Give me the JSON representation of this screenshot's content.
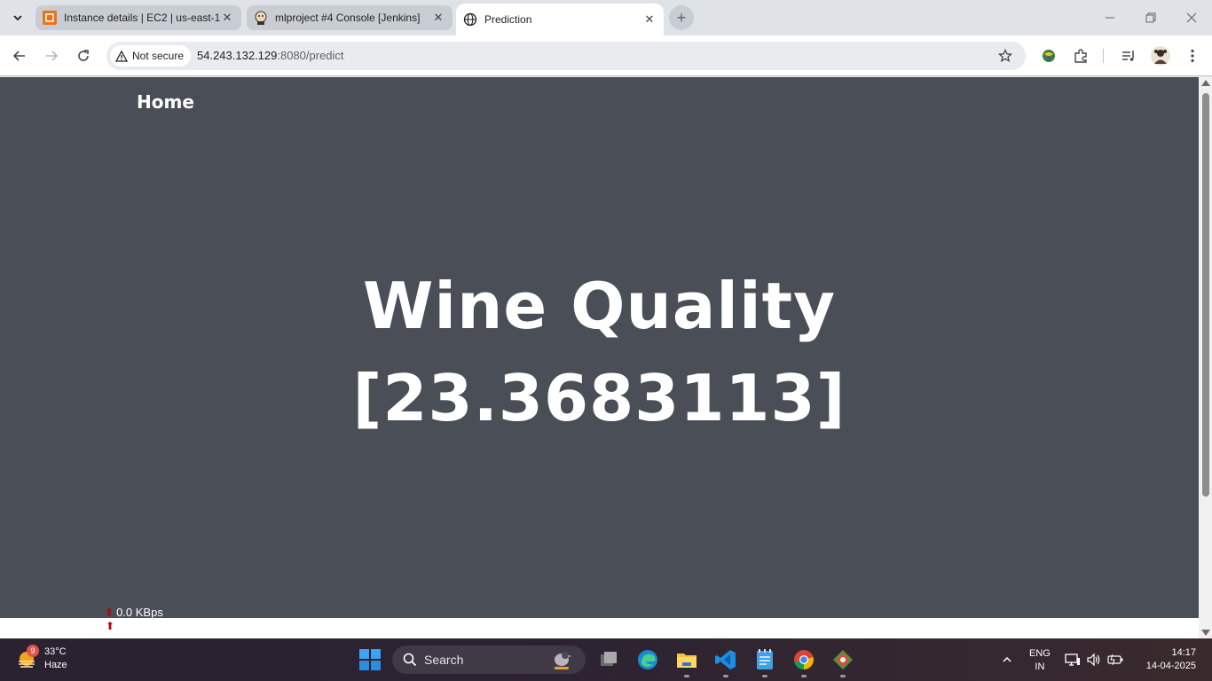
{
  "browser": {
    "tabs": [
      {
        "title": "Instance details | EC2 | us-east-1",
        "favicon": "aws-ec2-icon",
        "active": false
      },
      {
        "title": "mlproject #4 Console [Jenkins]",
        "favicon": "jenkins-icon",
        "active": false
      },
      {
        "title": "Prediction",
        "favicon": "globe-icon",
        "active": true
      }
    ],
    "security_label": "Not secure",
    "url_host": "54.243.132.129",
    "url_rest": ":8080/predict"
  },
  "page": {
    "nav_link": "Home",
    "heading_line1": "Wine Quality",
    "heading_line2": "[23.3683113]",
    "net_speed": "0.0 KBps"
  },
  "taskbar": {
    "weather_badge": "9",
    "temperature": "33°C",
    "condition": "Haze",
    "search_label": "Search",
    "lang_line1": "ENG",
    "lang_line2": "IN",
    "time": "14:17",
    "date": "14-04-2025"
  }
}
